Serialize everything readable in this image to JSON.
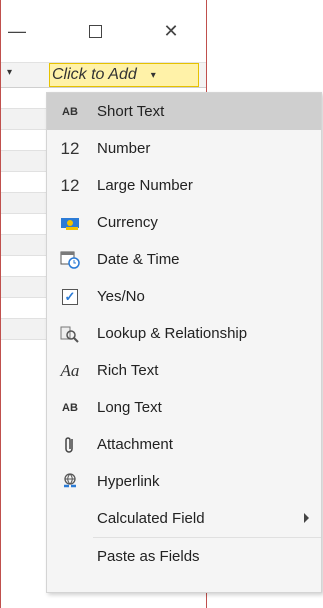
{
  "window": {
    "min_glyph": "—",
    "close_glyph": "✕"
  },
  "header": {
    "prev_dropdown_glyph": "▾",
    "click_to_add": "Click to Add",
    "click_dropdown_glyph": "▾"
  },
  "menu": {
    "items": [
      {
        "icon": "ab-text-icon",
        "glyph": "AB",
        "label": "Short Text"
      },
      {
        "icon": "number-icon",
        "glyph": "12",
        "label": "Number"
      },
      {
        "icon": "large-number-icon",
        "glyph": "12",
        "label": "Large Number"
      },
      {
        "icon": "currency-icon",
        "glyph": "",
        "label": "Currency"
      },
      {
        "icon": "calendar-clock-icon",
        "glyph": "",
        "label": "Date & Time"
      },
      {
        "icon": "checkbox-icon",
        "glyph": "✓",
        "label": "Yes/No"
      },
      {
        "icon": "lookup-icon",
        "glyph": "",
        "label": "Lookup & Relationship"
      },
      {
        "icon": "rich-text-icon",
        "glyph": "Aa",
        "label": "Rich Text"
      },
      {
        "icon": "long-text-icon",
        "glyph": "AB",
        "label": "Long Text"
      },
      {
        "icon": "paperclip-icon",
        "glyph": "",
        "label": "Attachment"
      },
      {
        "icon": "hyperlink-icon",
        "glyph": "",
        "label": "Hyperlink"
      },
      {
        "icon": "",
        "glyph": "",
        "label": "Calculated Field"
      },
      {
        "icon": "",
        "glyph": "",
        "label": "Paste as Fields"
      }
    ]
  },
  "colors": {
    "click_to_add_bg": "#fff2a8",
    "window_border": "#c0504d",
    "selected_bg": "#cfcfcf"
  }
}
